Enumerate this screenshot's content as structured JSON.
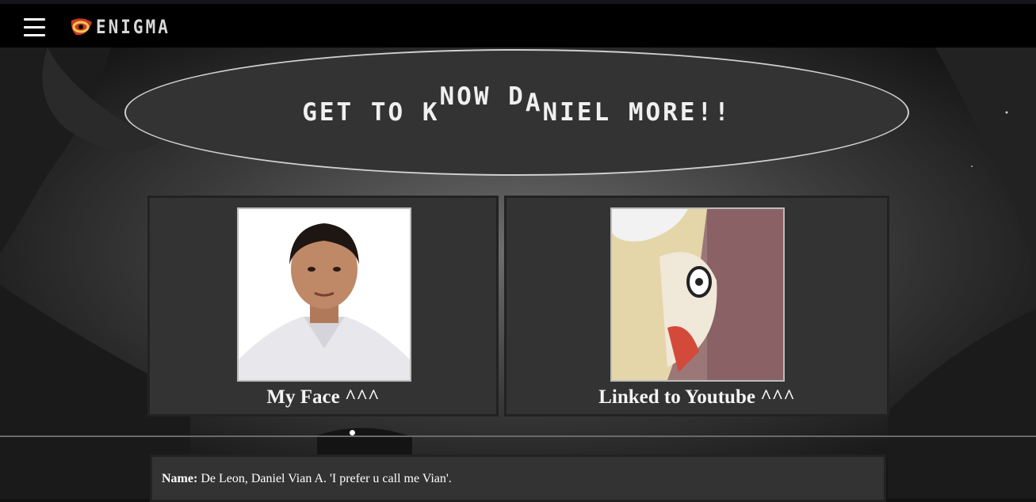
{
  "header": {
    "menu_icon": "hamburger-icon",
    "logo_text": "ENIGMA"
  },
  "banner": {
    "parts": [
      "GET TO K",
      "NOW D",
      "A",
      "NIEL MORE!!"
    ]
  },
  "cards": [
    {
      "caption": "My Face ^^^",
      "image": "portrait-photo"
    },
    {
      "caption": "Linked to Youtube ^^^",
      "image": "anime-face-thumbnail"
    }
  ],
  "info": {
    "name_label": "Name:",
    "name_value": "De Leon, Daniel Vian A. 'I prefer u call me Vian'."
  },
  "colors": {
    "navbar": "#000000",
    "panel": "#333333",
    "text": "#f0f0f0"
  }
}
